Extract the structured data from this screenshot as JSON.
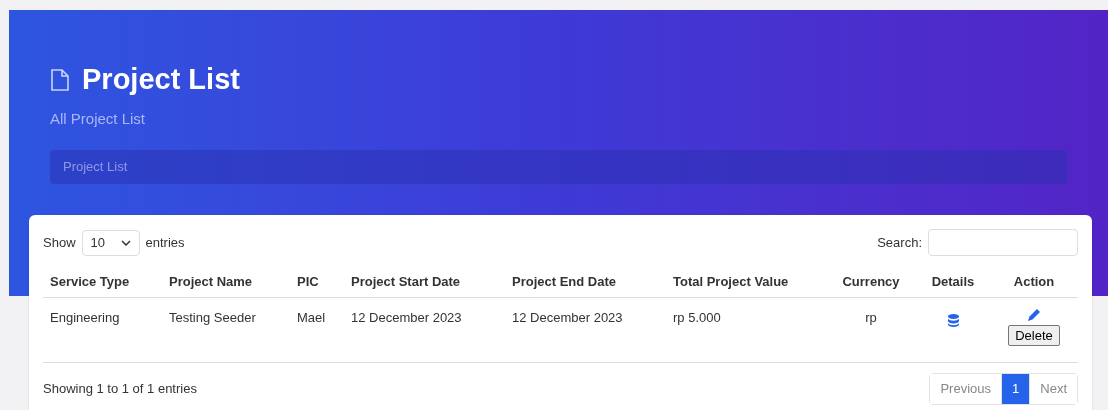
{
  "header": {
    "title": "Project List",
    "subtitle": "All Project List",
    "breadcrumb": "Project List"
  },
  "controls": {
    "show_label": "Show",
    "page_length": "10",
    "entries_label": "entries",
    "search_label": "Search:"
  },
  "table": {
    "columns": [
      "Service Type",
      "Project Name",
      "PIC",
      "Project Start Date",
      "Project End Date",
      "Total Project Value",
      "Currency",
      "Details",
      "Action"
    ],
    "rows": [
      {
        "cells": [
          "Engineering",
          "Testing Seeder",
          "Mael",
          "12 December 2023",
          "12 December 2023",
          "rp 5.000",
          "rp"
        ],
        "action_button": "Delete"
      }
    ]
  },
  "footer": {
    "info": "Showing 1 to 1 of 1 entries",
    "pagination": [
      {
        "label": "Previous",
        "selected": false,
        "disabled": true
      },
      {
        "label": "1",
        "selected": true,
        "disabled": false
      },
      {
        "label": "Next",
        "selected": false,
        "disabled": true
      }
    ]
  }
}
